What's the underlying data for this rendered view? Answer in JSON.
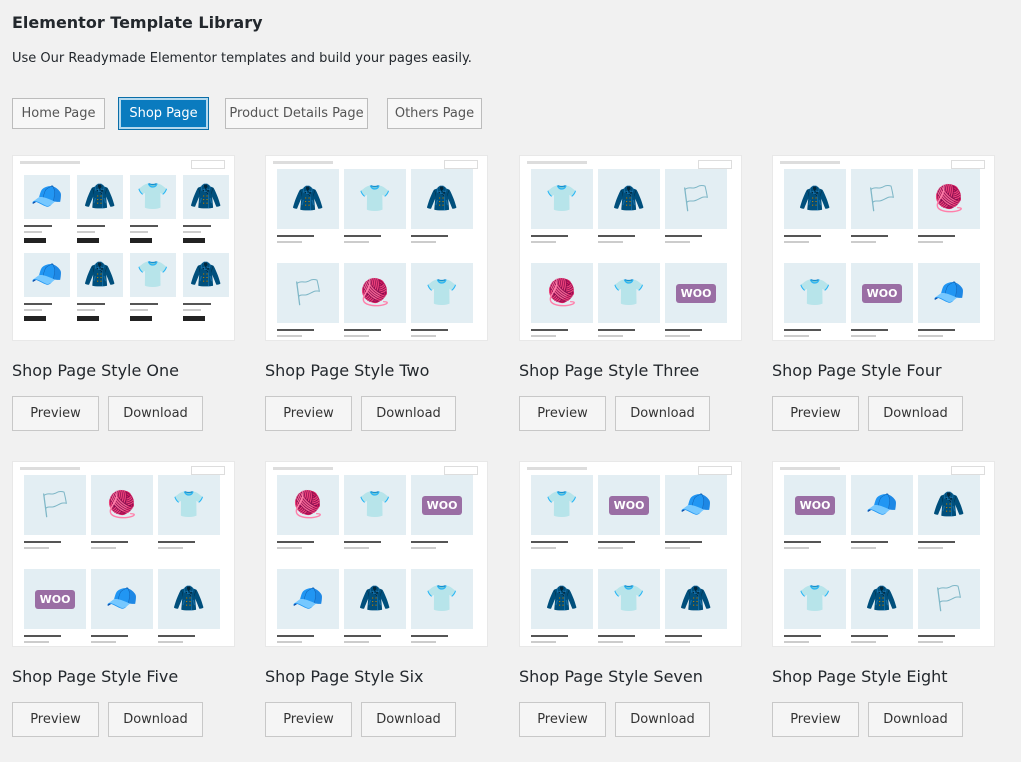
{
  "header": {
    "title": "Elementor Template Library",
    "description": "Use Our Readymade Elementor templates and build your pages easily."
  },
  "tabs": [
    {
      "label": "Home Page",
      "active": false
    },
    {
      "label": "Shop Page",
      "active": true
    },
    {
      "label": "Product Details Page",
      "active": false
    },
    {
      "label": "Others Page",
      "active": false
    }
  ],
  "templates": [
    {
      "title": "Shop Page Style One",
      "preview_label": "Preview",
      "download_label": "Download"
    },
    {
      "title": "Shop Page Style Two",
      "preview_label": "Preview",
      "download_label": "Download"
    },
    {
      "title": "Shop Page Style Three",
      "preview_label": "Preview",
      "download_label": "Download"
    },
    {
      "title": "Shop Page Style Four",
      "preview_label": "Preview",
      "download_label": "Download"
    },
    {
      "title": "Shop Page Style Five",
      "preview_label": "Preview",
      "download_label": "Download"
    },
    {
      "title": "Shop Page Style Six",
      "preview_label": "Preview",
      "download_label": "Download"
    },
    {
      "title": "Shop Page Style Seven",
      "preview_label": "Preview",
      "download_label": "Download"
    },
    {
      "title": "Shop Page Style Eight",
      "preview_label": "Preview",
      "download_label": "Download"
    }
  ],
  "colors": {
    "accent": "#0a7bbf",
    "background": "#f1f1f1",
    "thumb_tile": "#e3eef3",
    "woo_badge": "#9a6ea4"
  },
  "icons": {
    "thumbnail_products": [
      "cap-icon",
      "hoodie-icon",
      "tshirt-icon",
      "pennant-icon",
      "beanie-icon",
      "woo-poster-icon"
    ]
  }
}
